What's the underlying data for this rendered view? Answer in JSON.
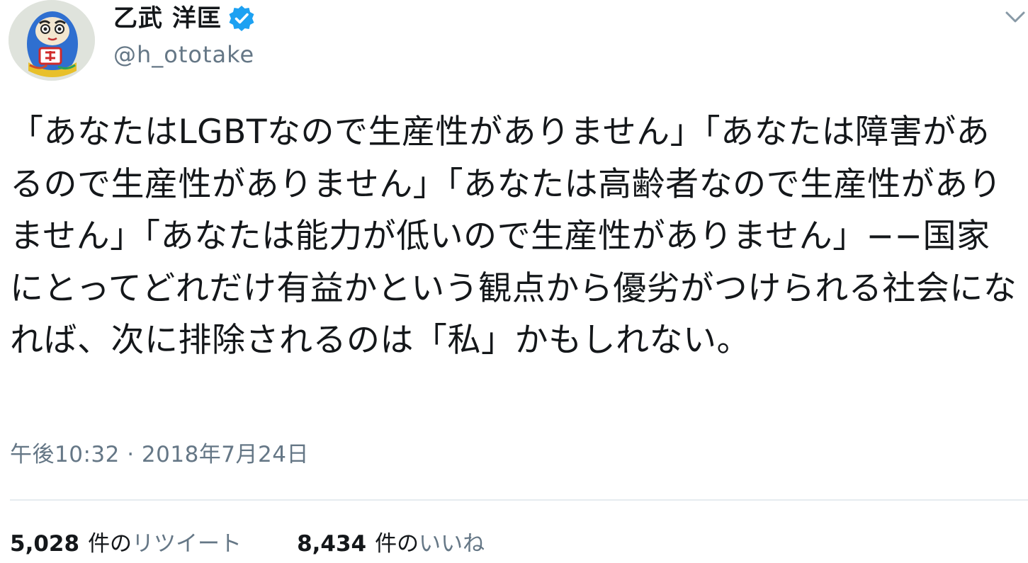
{
  "author": {
    "display_name": "乙武 洋匡",
    "handle": "@h_ototake",
    "verified": true,
    "avatar": "daruma-avatar"
  },
  "tweet": {
    "text": "「あなたはLGBTなので生産性がありません」「あなたは障害があるので生産性がありません」「あなたは高齢者なので生産性がありません」「あなたは能力が低いので生産性がありません」−−国家にとってどれだけ有益かという観点から優劣がつけられる社会になれば、次に排除されるのは「私」かもしれない。",
    "timestamp": "午後10:32 · 2018年7月24日"
  },
  "stats": {
    "retweets": {
      "count": "5,028",
      "unit": "件の",
      "label": "リツイート"
    },
    "likes": {
      "count": "8,434",
      "unit": "件の",
      "label": "いいね"
    }
  },
  "icons": {
    "verified": "verified-badge-icon",
    "menu": "chevron-down-icon"
  },
  "colors": {
    "text": "#14171a",
    "secondary": "#657786",
    "verified": "#1da1f2",
    "divider": "#e6ecf0"
  }
}
